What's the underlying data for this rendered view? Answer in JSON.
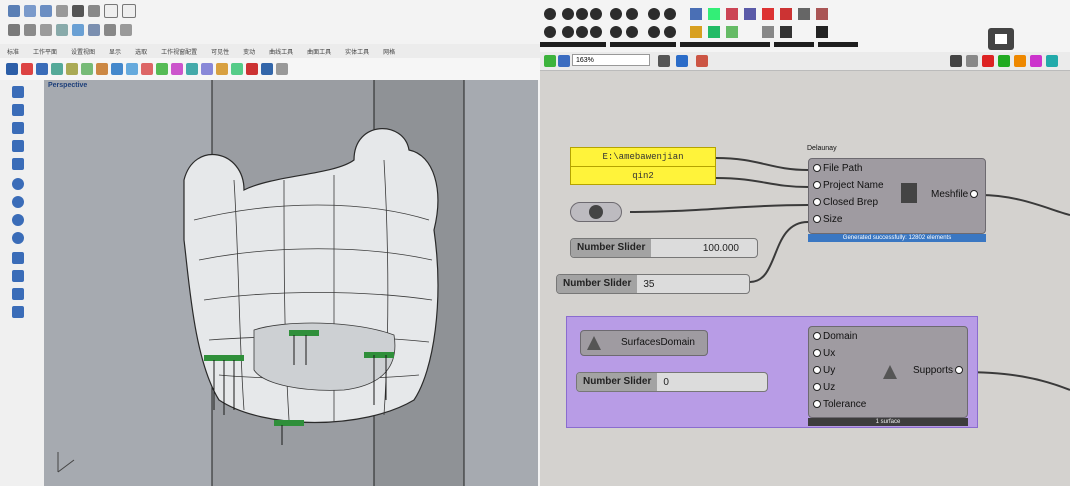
{
  "rhino": {
    "tabs": [
      "标准",
      "工作平面",
      "设置视图",
      "显示",
      "选取",
      "工作视窗配置",
      "可见性",
      "变动",
      "曲线工具",
      "曲面工具",
      "实体工具",
      "网格"
    ],
    "viewport_label": "Perspective"
  },
  "grasshopper": {
    "zoom": "163%",
    "delaunay": {
      "title": "Delaunay",
      "inputs": [
        "File Path",
        "Project Name",
        "Closed Brep",
        "Size"
      ],
      "output": "Meshfile",
      "status": "Generated successfully: 12802 elements"
    },
    "panel_path": "E:\\amebawenjian",
    "panel_name": "qin2",
    "slider_size": {
      "label": "Number Slider",
      "value": "100.000"
    },
    "slider_35": {
      "label": "Number Slider",
      "value": "35"
    },
    "surfaces_domain": {
      "label": "SurfacesDomain"
    },
    "slider_0": {
      "label": "Number Slider",
      "value": "0"
    },
    "supports": {
      "inputs": [
        "Domain",
        "Ux",
        "Uy",
        "Uz",
        "Tolerance"
      ],
      "output": "Supports",
      "status": "1 surface"
    },
    "group_color": "#b89ce6",
    "wire_color": "#3a3a3a"
  }
}
